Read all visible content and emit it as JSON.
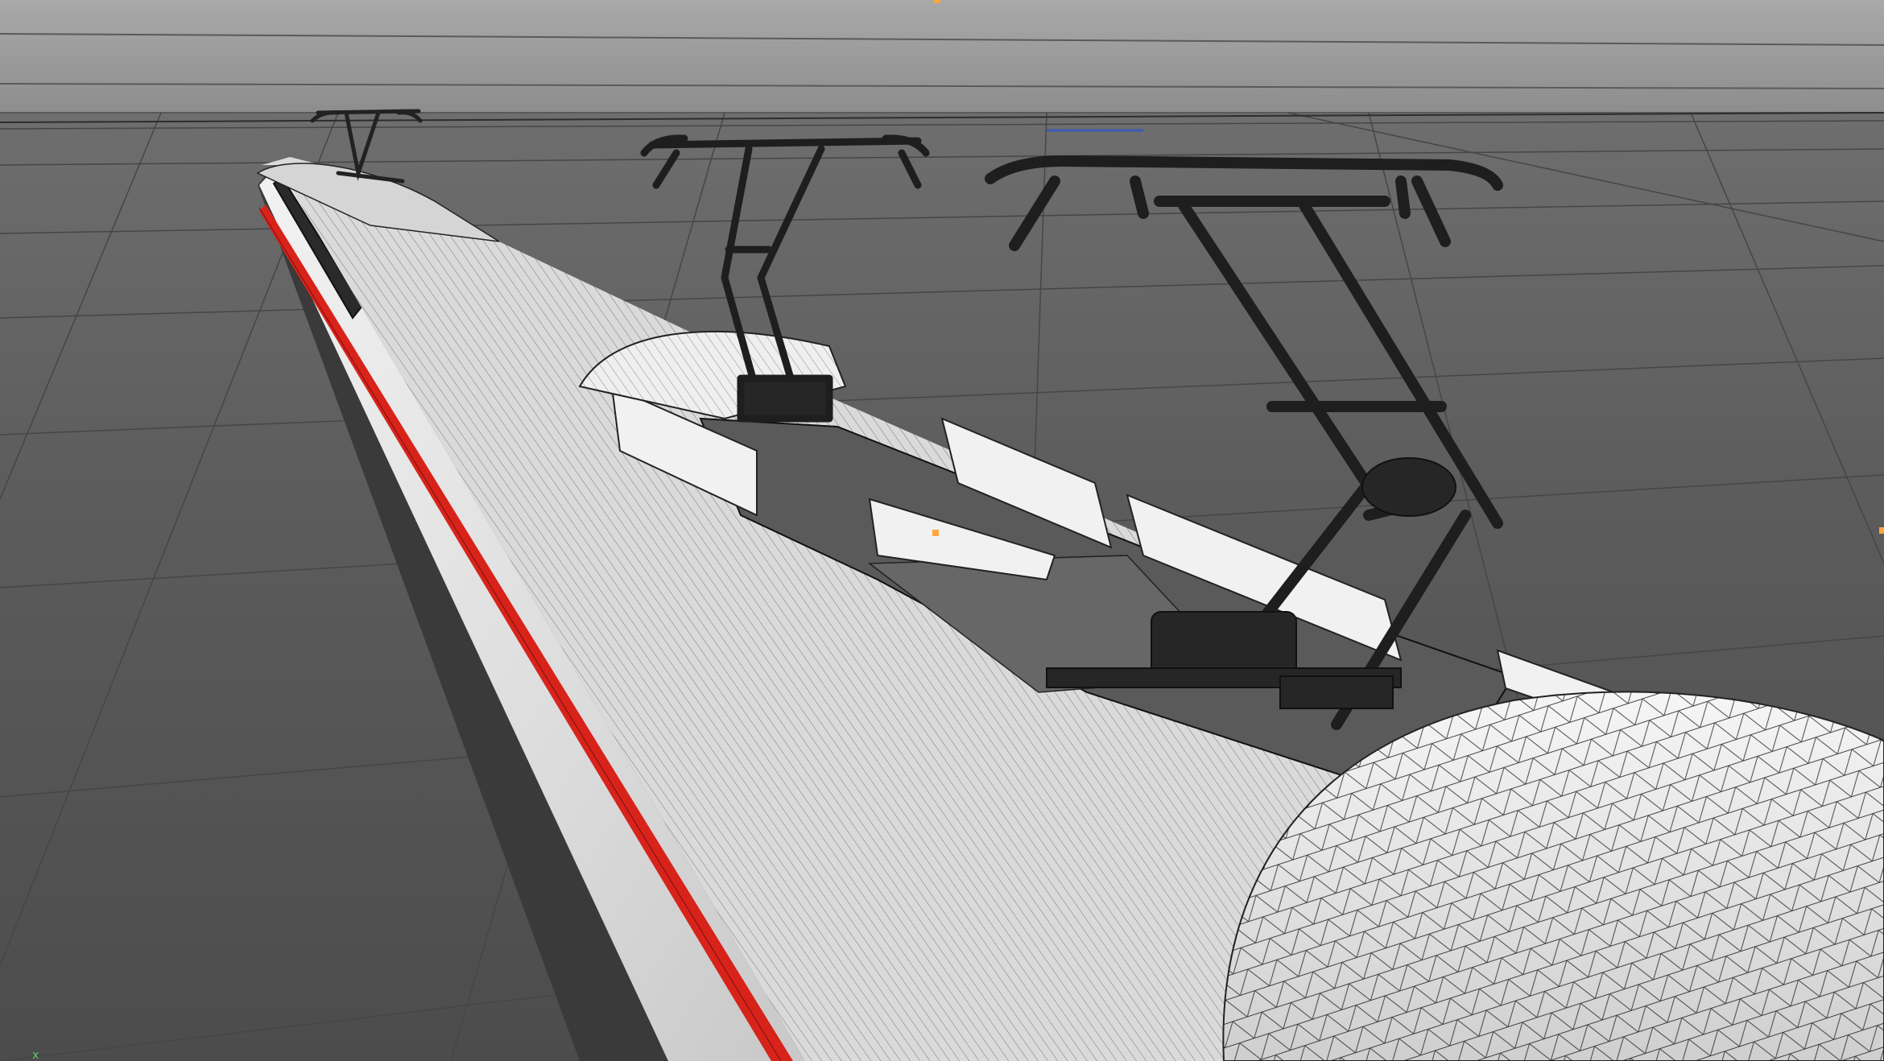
{
  "viewport": {
    "background_top": "#a6a6a6",
    "background_horizon": "#8a8a8a",
    "ground_color": "#555555",
    "grid_color": "#3f3f3f",
    "wire_color": "#1a1a1a",
    "body_color": "#e9e9e9",
    "body_shade": "#c9c9c9",
    "stripe_color": "#d8231a",
    "window_color": "#2b2b2b",
    "pantograph_color": "#222222",
    "selection_marker_color": "#ffa63d",
    "axis_x_color": "#5fd35f",
    "axis_label": "x"
  }
}
